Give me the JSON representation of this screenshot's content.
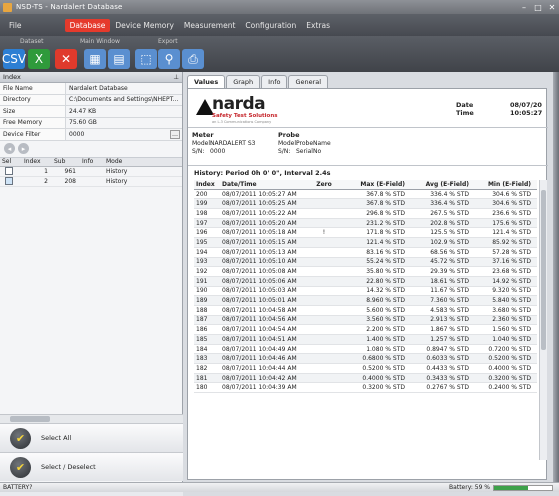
{
  "window": {
    "title": "NSD-TS - Nardalert Database"
  },
  "menu": {
    "items": [
      "File",
      "Database",
      "Device Memory",
      "Measurement",
      "Configuration",
      "Extras"
    ],
    "active": "Database"
  },
  "toolbar": {
    "groups": [
      "Dataset",
      "Main Window",
      "Export"
    ],
    "buttons": [
      {
        "name": "csv-export-icon",
        "label": "CSV",
        "color": "#2d7fd3"
      },
      {
        "name": "excel-export-icon",
        "label": "X",
        "color": "#2f9a3b"
      },
      {
        "name": "delete-icon",
        "label": "✕",
        "color": "#e03a2c"
      },
      {
        "name": "window-layout-icon",
        "label": "▦",
        "color": "#5a8fd0"
      },
      {
        "name": "window-tile-icon",
        "label": "▤",
        "color": "#5a8fd0"
      },
      {
        "name": "export-chart-icon",
        "label": "⬚",
        "color": "#5a8fd0"
      },
      {
        "name": "export-search-icon",
        "label": "⚲",
        "color": "#5a8fd0"
      },
      {
        "name": "export-print-icon",
        "label": "⎙",
        "color": "#5a8fd0"
      }
    ]
  },
  "index_panel": {
    "title": "Index",
    "props": [
      {
        "k": "File Name",
        "v": "Nardalert Database"
      },
      {
        "k": "Directory",
        "v": "C:\\Documents and Settings\\NHEPT..."
      },
      {
        "k": "Size",
        "v": "24.47 KB"
      },
      {
        "k": "Free Memory",
        "v": "75.60 GB"
      },
      {
        "k": "Device Filter",
        "v": "0000"
      }
    ],
    "columns": [
      "Sel",
      "Index",
      "Sub",
      "Info",
      "Mode"
    ],
    "rows": [
      {
        "sel": false,
        "index": "1",
        "sub": "961",
        "info": "",
        "mode": "History"
      },
      {
        "sel": true,
        "index": "2",
        "sub": "208",
        "info": "",
        "mode": "History"
      }
    ]
  },
  "actions": {
    "select_all": "Select All",
    "select_deselect": "Select / Deselect"
  },
  "tabs": [
    "Values",
    "Graph",
    "Info",
    "General"
  ],
  "report": {
    "brand": "narda",
    "brand_sub": "Safety Test Solutions",
    "brand_sub2": "an L-3 Communications Company",
    "date_label": "Date",
    "date_value": "08/07/20",
    "time_label": "Time",
    "time_value": "10:05:27",
    "meter": {
      "title": "Meter",
      "model_label": "Model:",
      "model": "NARDALERT S3",
      "sn_label": "S/N:",
      "sn": "0000"
    },
    "probe": {
      "title": "Probe",
      "model_label": "Model:",
      "model": "ProbeName",
      "sn_label": "S/N:",
      "sn": "SerialNo"
    },
    "history": "History: Period 0h 0' 0\", Interval 2.4s",
    "columns": [
      "Index",
      "Date/Time",
      "Zero",
      "Max (E-Field)",
      "Avg (E-Field)",
      "Min (E-Field)"
    ],
    "rows": [
      [
        "200",
        "08/07/2011 10:05:27 AM",
        "",
        "367.8 % STD",
        "336.4 % STD",
        "304.6 % STD"
      ],
      [
        "199",
        "08/07/2011 10:05:25 AM",
        "",
        "367.8 % STD",
        "336.4 % STD",
        "304.6 % STD"
      ],
      [
        "198",
        "08/07/2011 10:05:22 AM",
        "",
        "296.8 % STD",
        "267.5 % STD",
        "236.6 % STD"
      ],
      [
        "197",
        "08/07/2011 10:05:20 AM",
        "",
        "231.2 % STD",
        "202.8 % STD",
        "175.6 % STD"
      ],
      [
        "196",
        "08/07/2011 10:05:18 AM",
        "!",
        "171.8 % STD",
        "125.5 % STD",
        "121.4 % STD"
      ],
      [
        "195",
        "08/07/2011 10:05:15 AM",
        "",
        "121.4 % STD",
        "102.9 % STD",
        "85.92 % STD"
      ],
      [
        "194",
        "08/07/2011 10:05:13 AM",
        "",
        "83.16 % STD",
        "68.56 % STD",
        "57.28 % STD"
      ],
      [
        "193",
        "08/07/2011 10:05:10 AM",
        "",
        "55.24 % STD",
        "45.72 % STD",
        "37.16 % STD"
      ],
      [
        "192",
        "08/07/2011 10:05:08 AM",
        "",
        "35.80 % STD",
        "29.39 % STD",
        "23.68 % STD"
      ],
      [
        "191",
        "08/07/2011 10:05:06 AM",
        "",
        "22.80 % STD",
        "18.61 % STD",
        "14.92 % STD"
      ],
      [
        "190",
        "08/07/2011 10:05:03 AM",
        "",
        "14.32 % STD",
        "11.67 % STD",
        "9.320 % STD"
      ],
      [
        "189",
        "08/07/2011 10:05:01 AM",
        "",
        "8.960 % STD",
        "7.360 % STD",
        "5.840 % STD"
      ],
      [
        "188",
        "08/07/2011 10:04:58 AM",
        "",
        "5.600 % STD",
        "4.583 % STD",
        "3.680 % STD"
      ],
      [
        "187",
        "08/07/2011 10:04:56 AM",
        "",
        "3.560 % STD",
        "2.913 % STD",
        "2.360 % STD"
      ],
      [
        "186",
        "08/07/2011 10:04:54 AM",
        "",
        "2.200 % STD",
        "1.867 % STD",
        "1.560 % STD"
      ],
      [
        "185",
        "08/07/2011 10:04:51 AM",
        "",
        "1.400 % STD",
        "1.257 % STD",
        "1.040 % STD"
      ],
      [
        "184",
        "08/07/2011 10:04:49 AM",
        "",
        "1.080 % STD",
        "0.8947 % STD",
        "0.7200 % STD"
      ],
      [
        "183",
        "08/07/2011 10:04:46 AM",
        "",
        "0.6800 % STD",
        "0.6033 % STD",
        "0.5200 % STD"
      ],
      [
        "182",
        "08/07/2011 10:04:44 AM",
        "",
        "0.5200 % STD",
        "0.4433 % STD",
        "0.4000 % STD"
      ],
      [
        "181",
        "08/07/2011 10:04:42 AM",
        "",
        "0.4000 % STD",
        "0.3433 % STD",
        "0.3200 % STD"
      ],
      [
        "180",
        "08/07/2011 10:04:39 AM",
        "",
        "0.3200 % STD",
        "0.2767 % STD",
        "0.2400 % STD"
      ]
    ]
  },
  "status": {
    "left": "BATTERY?",
    "battery_label": "Battery: 59 %",
    "battery_pct": 59
  }
}
